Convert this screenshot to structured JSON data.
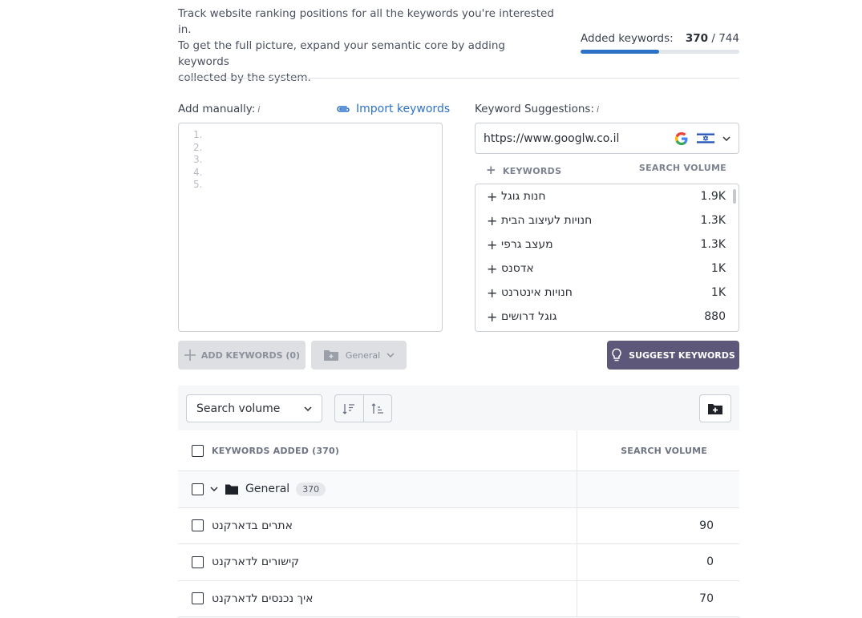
{
  "intro": {
    "line1": "Track website ranking positions for all the keywords you're interested in.",
    "line2": "To get the full picture, expand your semantic core by adding keywords",
    "line3": "collected by the system."
  },
  "added": {
    "label": "Added keywords:",
    "current": "370",
    "separator": "/",
    "total": "744",
    "progress_fraction": 0.497
  },
  "manual": {
    "label": "Add manually:",
    "info": "i",
    "import_label": "Import keywords",
    "line_numbers": [
      "1.",
      "2.",
      "3.",
      "4.",
      "5."
    ]
  },
  "buttons": {
    "add_keywords": "ADD KEYWORDS (0)",
    "group": "General",
    "suggest": "SUGGEST KEYWORDS"
  },
  "suggestions": {
    "label": "Keyword Suggestions:",
    "info": "i",
    "url": "https://www.googlw.co.il",
    "col_keywords": "KEYWORDS",
    "col_volume": "SEARCH VOLUME",
    "rows": [
      {
        "kw": "חנות גוגל",
        "vol": "1.9K"
      },
      {
        "kw": "חנויות לעיצוב הבית",
        "vol": "1.3K"
      },
      {
        "kw": "מעצב גרפי",
        "vol": "1.3K"
      },
      {
        "kw": "אדסנס",
        "vol": "1K"
      },
      {
        "kw": "חנויות אינטרנט",
        "vol": "1K"
      },
      {
        "kw": "גוגל דרושים",
        "vol": "880"
      }
    ]
  },
  "sort": {
    "selected": "Search volume"
  },
  "table": {
    "col_keywords": "KEYWORDS ADDED (370)",
    "col_volume": "SEARCH VOLUME",
    "group": {
      "name": "General",
      "count": "370"
    },
    "rows": [
      {
        "kw": "אתרים בדארקנט",
        "vol": "90"
      },
      {
        "kw": "קישורים לדארקנט",
        "vol": "0"
      },
      {
        "kw": "איך נכנסים לדארקנט",
        "vol": "70"
      }
    ]
  },
  "colors": {
    "accent": "#2d72c7",
    "suggest_button": "#5d5779",
    "disabled_button": "#dddfe3"
  },
  "icons": [
    "paperclip-icon",
    "google-icon",
    "israel-flag-icon",
    "chevron-down-icon",
    "plus-icon",
    "folder-plus-icon",
    "lightbulb-icon",
    "sort-desc-icon",
    "sort-asc-icon",
    "folder-icon"
  ]
}
